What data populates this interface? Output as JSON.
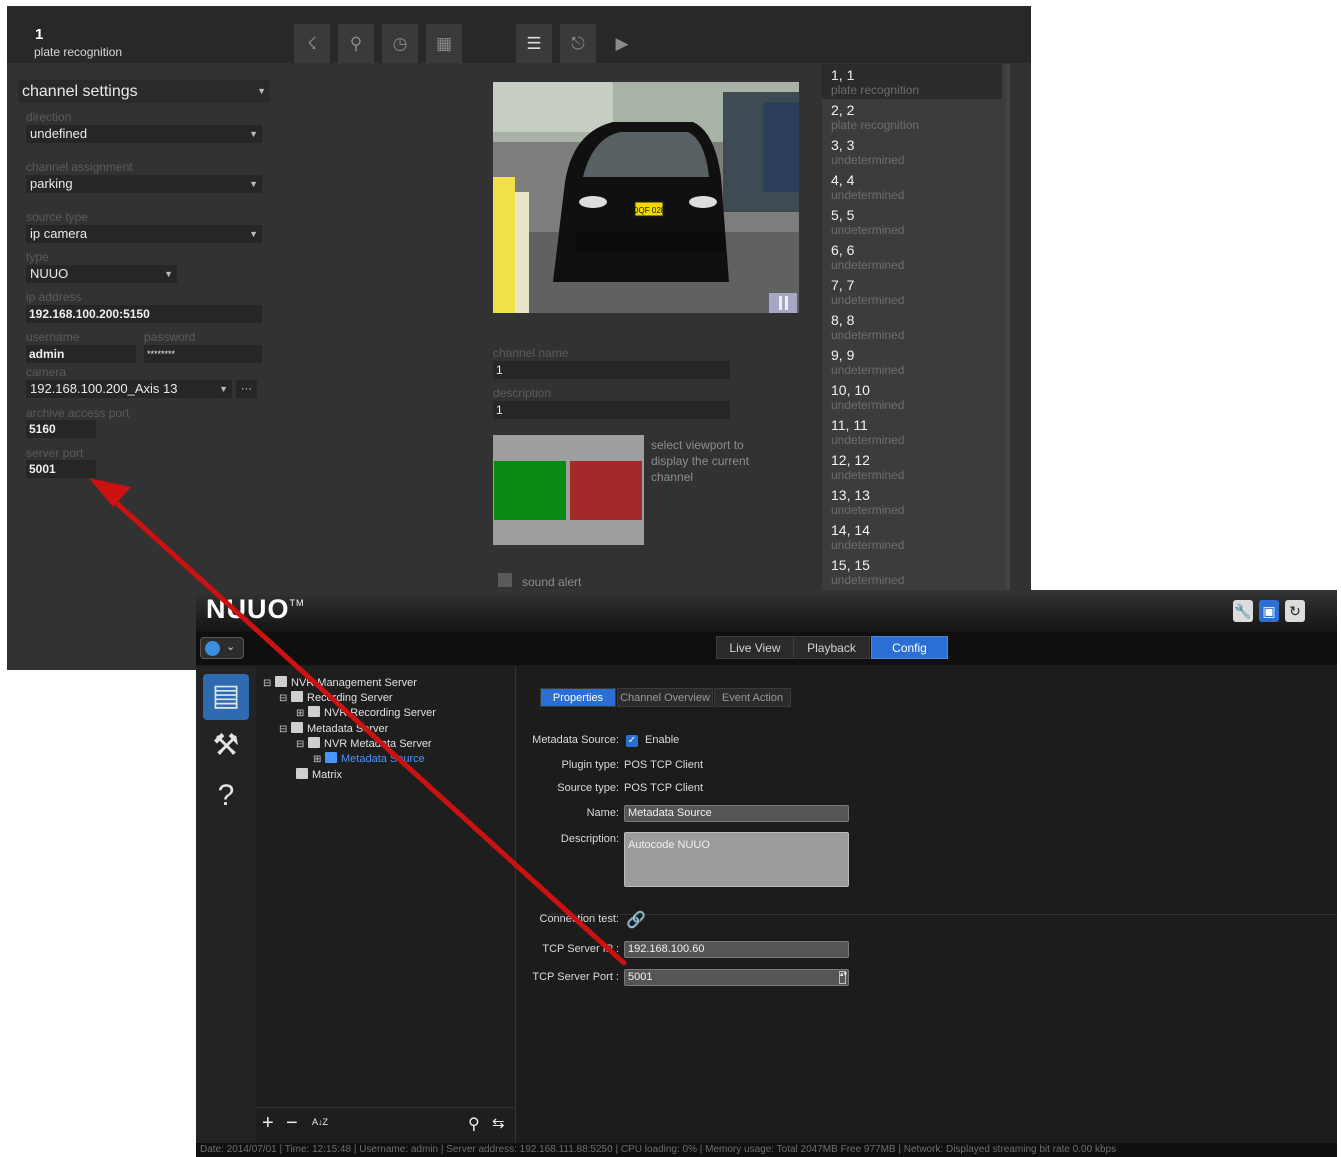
{
  "channel_config": {
    "channel_number": "1",
    "channel_title": "plate recognition",
    "section_dropdown": "channel settings",
    "direction": {
      "label": "direction",
      "value": "undefined"
    },
    "channel_assignment": {
      "label": "channel assignment",
      "value": "parking"
    },
    "source_type": {
      "label": "source type",
      "value": "ip camera"
    },
    "type": {
      "label": "type",
      "value": "NUUO"
    },
    "ip_address": {
      "label": "ip address",
      "value": "192.168.100.200:5150"
    },
    "username": {
      "label": "username",
      "value": "admin"
    },
    "password": {
      "label": "password",
      "value": "********"
    },
    "camera": {
      "label": "camera",
      "value": "192.168.100.200_Axis 13",
      "browse": "···"
    },
    "archive_access_port": {
      "label": "archive access port",
      "value": "5160"
    },
    "server_port": {
      "label": "server port",
      "value": "5001"
    },
    "channel_name": {
      "label": "channel name",
      "value": "1"
    },
    "description": {
      "label": "description",
      "value": "1"
    },
    "viewport_hint": "select viewport to display the current channel",
    "sound_alert_label": "sound alert",
    "plate_text": "DQF 028",
    "toolbar_icons": [
      "user-icon",
      "key-icon",
      "clock-icon",
      "grid-icon",
      "list-settings-icon",
      "camera-settings-icon",
      "play-icon"
    ],
    "channels": [
      {
        "title": "1, 1",
        "status": "plate recognition"
      },
      {
        "title": "2, 2",
        "status": "plate recognition"
      },
      {
        "title": "3, 3",
        "status": "undetermined"
      },
      {
        "title": "4, 4",
        "status": "undetermined"
      },
      {
        "title": "5, 5",
        "status": "undetermined"
      },
      {
        "title": "6, 6",
        "status": "undetermined"
      },
      {
        "title": "7, 7",
        "status": "undetermined"
      },
      {
        "title": "8, 8",
        "status": "undetermined"
      },
      {
        "title": "9, 9",
        "status": "undetermined"
      },
      {
        "title": "10, 10",
        "status": "undetermined"
      },
      {
        "title": "11, 11",
        "status": "undetermined"
      },
      {
        "title": "12, 12",
        "status": "undetermined"
      },
      {
        "title": "13, 13",
        "status": "undetermined"
      },
      {
        "title": "14, 14",
        "status": "undetermined"
      },
      {
        "title": "15, 15",
        "status": "undetermined"
      }
    ]
  },
  "nuuo": {
    "logo": "NUUO",
    "logo_tm": "TM",
    "header_icons": [
      "wrench-icon",
      "monitor-icon",
      "refresh-icon"
    ],
    "tabs": [
      "Live View",
      "Playback",
      "Config"
    ],
    "active_tab": "Config",
    "tree": {
      "root": "NVR Management Server",
      "recording_server": "Recording Server",
      "nvr_recording_server": "NVR Recording Server",
      "metadata_server": "Metadata Server",
      "nvr_metadata_server": "NVR Metadata Server",
      "metadata_source": "Metadata Source",
      "matrix": "Matrix"
    },
    "prop_tabs": [
      "Properties",
      "Channel Overview",
      "Event Action"
    ],
    "form": {
      "metadata_source_label": "Metadata Source:",
      "enable_label": "Enable",
      "plugin_type_label": "Plugin type:",
      "plugin_type_value": "POS TCP Client",
      "source_type_label": "Source type:",
      "source_type_value": "POS TCP Client",
      "name_label": "Name:",
      "name_value": "Metadata Source",
      "description_label": "Description:",
      "description_value": "Autocode NUUO",
      "connection_test_label": "Connection test:",
      "tcp_ip_label": "TCP Server IP :",
      "tcp_ip_value": "192.168.100.60",
      "tcp_port_label": "TCP Server Port :",
      "tcp_port_value": "5001"
    },
    "tree_tools": [
      "+",
      "−",
      "A↓Z"
    ],
    "status_bar": "Date: 2014/07/01  |  Time: 12:15:48  |  Username: admin  |  Server address: 192.168.111.88:5250  |  CPU loading: 0%  |  Memory usage: Total 2047MB  Free 977MB  |  Network: Displayed streaming bit rate    0.00 kbps"
  },
  "colors": {
    "accent": "#2c6fd4",
    "arrow": "#cc1111",
    "viewport_green": "#0a8a12",
    "viewport_red": "#a22a2a"
  }
}
